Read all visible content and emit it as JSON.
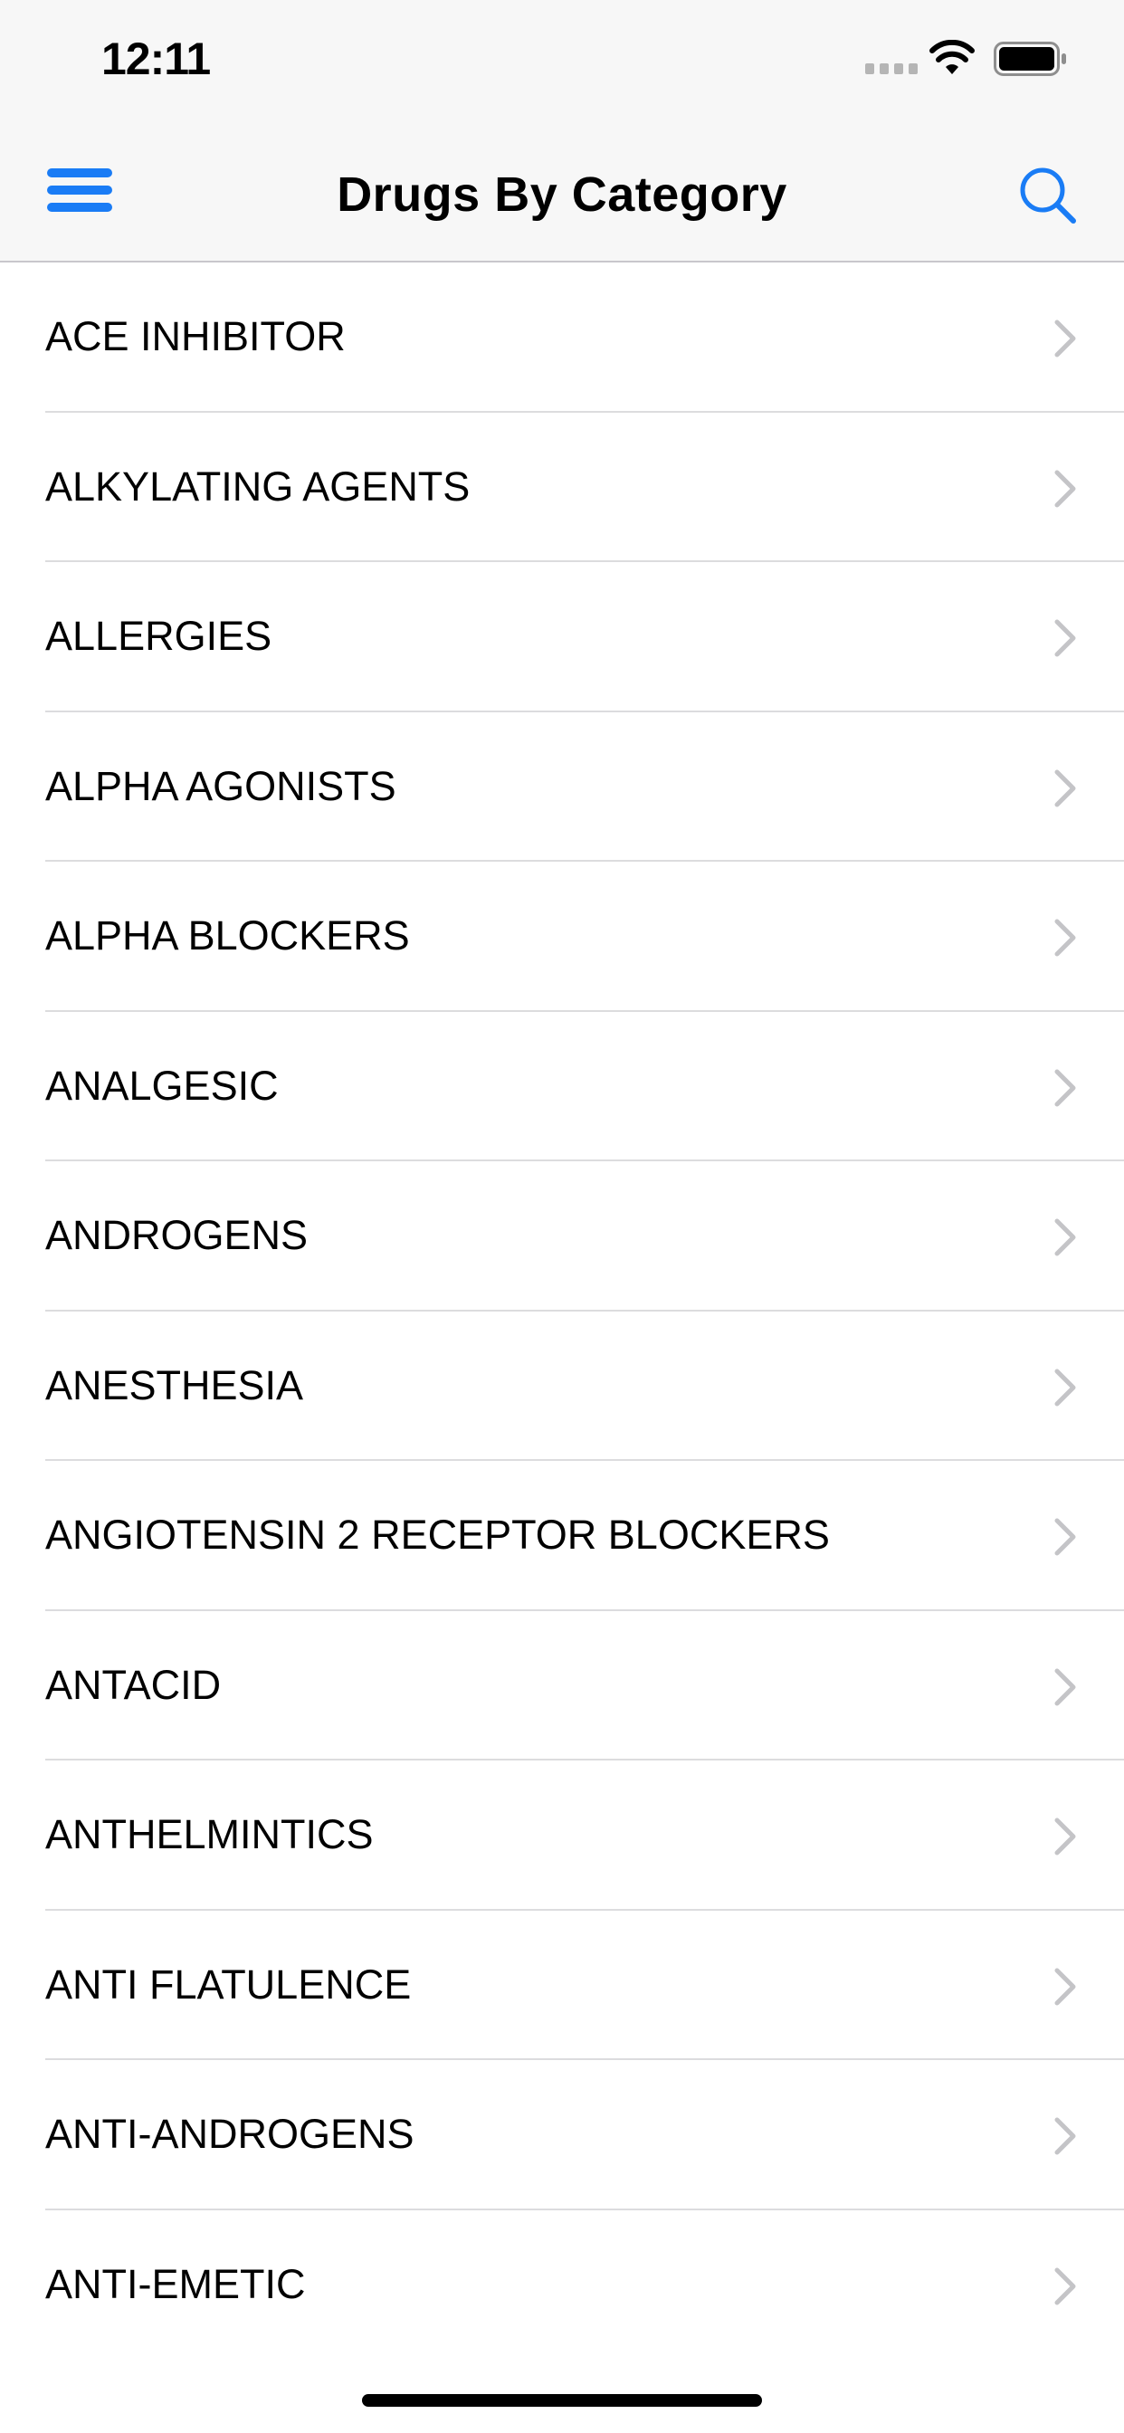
{
  "status_bar": {
    "time": "12:11",
    "icons": [
      "signal-icon",
      "wifi-icon",
      "battery-icon"
    ]
  },
  "nav": {
    "title": "Drugs By Category",
    "left_icon": "menu-icon",
    "right_icon": "search-icon"
  },
  "colors": {
    "accent": "#1a7cf5",
    "separator": "#dcdcde",
    "chevron": "#c4c4c7",
    "bar_background": "#f7f7f7"
  },
  "categories": [
    "ACE INHIBITOR",
    "ALKYLATING AGENTS",
    "ALLERGIES",
    "ALPHA AGONISTS",
    "ALPHA BLOCKERS",
    "ANALGESIC",
    "ANDROGENS",
    "ANESTHESIA",
    "ANGIOTENSIN 2 RECEPTOR BLOCKERS",
    "ANTACID",
    "ANTHELMINTICS",
    "ANTI FLATULENCE",
    "ANTI-ANDROGENS",
    "ANTI-EMETIC"
  ]
}
